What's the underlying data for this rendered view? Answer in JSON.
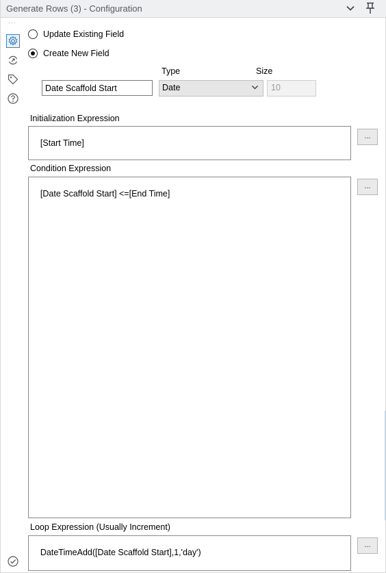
{
  "window": {
    "title": "Generate Rows (3) - Configuration",
    "collapse_icon": "chevron-down-icon",
    "pin_icon": "pin-icon"
  },
  "sidebar": {
    "overflow_dots": "...",
    "items": [
      {
        "name": "configuration",
        "icon": "gear-icon",
        "active": true
      },
      {
        "name": "annotation",
        "icon": "rename-icon",
        "active": false
      },
      {
        "name": "tags",
        "icon": "tag-icon",
        "active": false
      },
      {
        "name": "help",
        "icon": "help-icon",
        "active": false
      }
    ],
    "footer_icon": "check-circle-icon"
  },
  "field_mode": {
    "options": [
      {
        "label": "Update Existing Field",
        "checked": false
      },
      {
        "label": "Create New  Field",
        "checked": true
      }
    ]
  },
  "new_field": {
    "name_value": "Date Scaffold Start",
    "type_header": "Type",
    "size_header": "Size",
    "type_value": "Date",
    "size_value": "10"
  },
  "init_expr": {
    "label": "Initialization Expression",
    "value": "[Start Time]",
    "button": "..."
  },
  "cond_expr": {
    "label": "Condition Expression",
    "value": "[Date Scaffold Start] <=[End Time]",
    "button": "..."
  },
  "loop_expr": {
    "label": "Loop Expression (Usually Increment)",
    "value": "DateTimeAdd([Date Scaffold Start],1,'day')",
    "button": "..."
  },
  "colors": {
    "titlebar_bg": "#eef0f2",
    "accent": "#3b7fc4",
    "select_bg": "#e6e6e6"
  }
}
